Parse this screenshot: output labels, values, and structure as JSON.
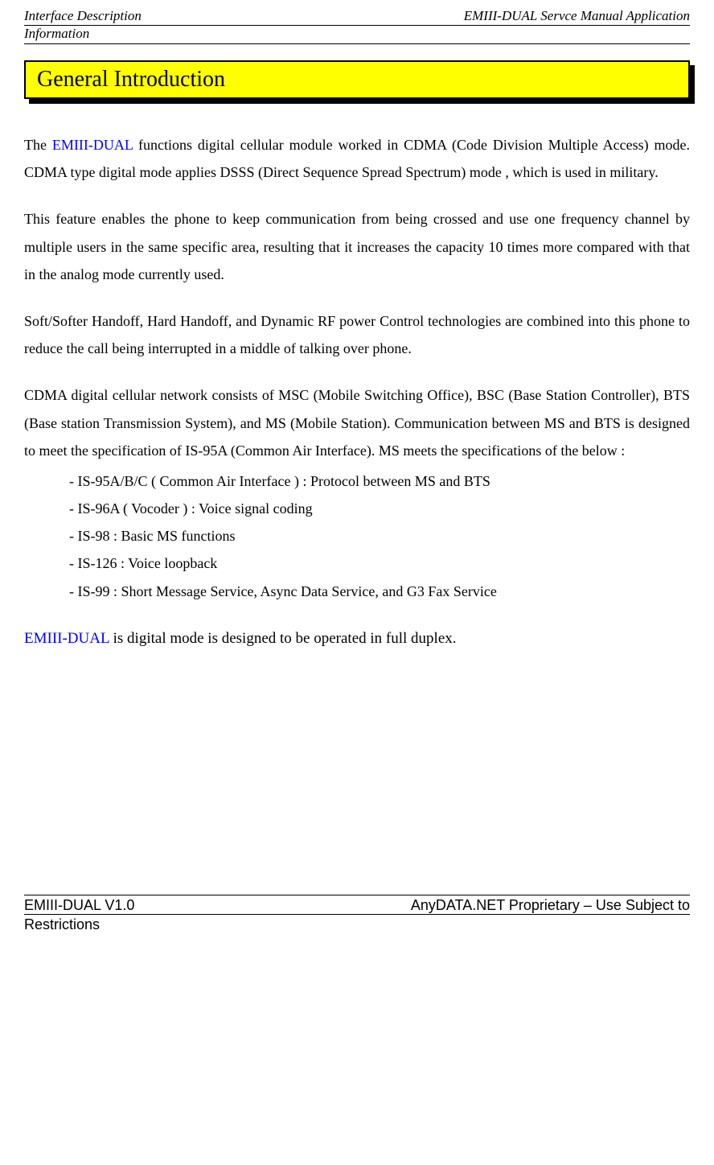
{
  "header": {
    "left": "Interface Description",
    "right": "EMIII-DUAL Servce Manual Application",
    "sub": "Information"
  },
  "title": "General Introduction",
  "para1_pre": "The ",
  "para1_blue": "EMIII-DUAL",
  "para1_post": " functions digital cellular module worked in CDMA (Code Division Multiple Access) mode. CDMA type digital mode applies DSSS (Direct Sequence Spread Spectrum) mode , which is used in military.",
  "para2": "This feature enables the phone to keep communication from being crossed and use one frequency channel by multiple users in the same specific area, resulting that it increases the capacity 10 times more compared with that in the analog mode currently used.",
  "para3": "Soft/Softer Handoff, Hard Handoff, and Dynamic RF power Control technologies are combined into this phone to reduce the call being interrupted in a middle of talking over phone.",
  "para4": "CDMA digital cellular network consists of MSC (Mobile Switching Office), BSC (Base Station Controller), BTS (Base station Transmission System), and MS (Mobile Station). Communication between MS and BTS is designed to meet the specification of IS-95A (Common Air Interface). MS meets the specifications of the below :",
  "specs": [
    "- IS-95A/B/C ( Common Air Interface ) : Protocol between MS and BTS",
    "- IS-96A ( Vocoder ) : Voice signal coding",
    "- IS-98 : Basic MS functions",
    "- IS-126 : Voice loopback",
    "- IS-99 : Short Message Service, Async Data Service, and G3 Fax Service"
  ],
  "para5_blue": "EMIII-DUAL",
  "para5_post": " is digital mode is designed to be operated in full duplex.",
  "footer": {
    "left": "EMIII-DUAL V1.0",
    "right": "AnyDATA.NET Proprietary –  Use Subject to",
    "sub": "Restrictions"
  }
}
